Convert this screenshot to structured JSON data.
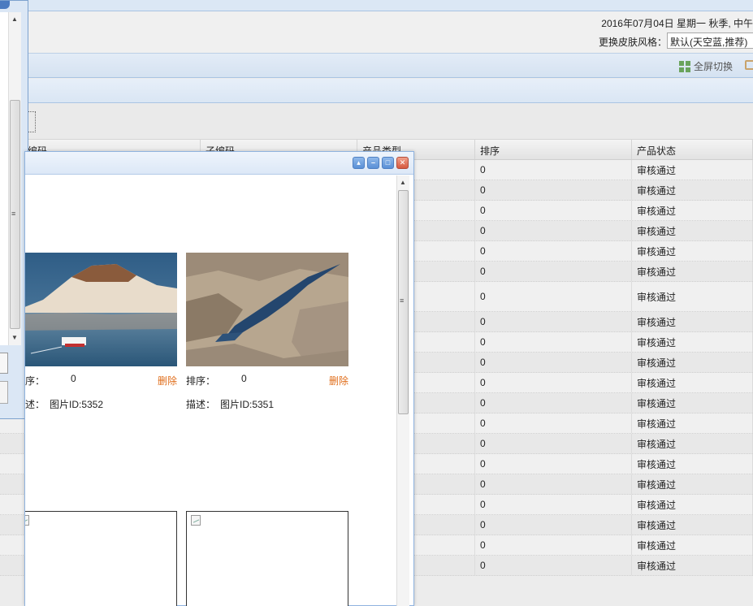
{
  "header": {
    "date_text": "2016年07月04日 星期一 秋季, 中午",
    "skin_label": "更换皮肤风格：",
    "skin_value": "默认(天空蓝,推荐)"
  },
  "toolbar": {
    "fullscreen_label": "全屏切换"
  },
  "grid": {
    "columns": [
      "编码",
      "子编码",
      "产品类型",
      "排序",
      "产品状态"
    ],
    "rows": [
      {
        "sort": "0",
        "status": "审核通过"
      },
      {
        "sort": "0",
        "status": "审核通过"
      },
      {
        "sort": "0",
        "status": "审核通过"
      },
      {
        "sort": "0",
        "status": "审核通过"
      },
      {
        "sort": "0",
        "status": "审核通过"
      },
      {
        "sort": "0",
        "status": "审核通过"
      },
      {
        "sort": "0",
        "status": "审核通过"
      },
      {
        "sort": "0",
        "status": "审核通过"
      },
      {
        "sort": "0",
        "status": "审核通过"
      },
      {
        "sort": "0",
        "status": "审核通过"
      },
      {
        "sort": "0",
        "status": "审核通过"
      },
      {
        "sort": "0",
        "status": "审核通过"
      },
      {
        "sort": "0",
        "status": "审核通过"
      },
      {
        "sort": "0",
        "status": "审核通过"
      },
      {
        "sort": "0",
        "status": "审核通过"
      },
      {
        "sort": "0",
        "status": "审核通过"
      },
      {
        "sort": "0",
        "status": "审核通过"
      },
      {
        "sort": "0",
        "status": "审核通过"
      },
      {
        "sort": "0",
        "status": "审核通过"
      },
      {
        "sort": "0",
        "status": "审核通过"
      }
    ]
  },
  "popup": {
    "cards": [
      {
        "sort_label": "序：",
        "sort_value": "0",
        "delete_label": "删除",
        "desc_label": "述：",
        "desc_value": "图片ID:5352"
      },
      {
        "sort_label": "排序：",
        "sort_value": "0",
        "delete_label": "删除",
        "desc_label": "描述：",
        "desc_value": "图片ID:5351"
      }
    ],
    "window_buttons": [
      "collapse",
      "minimize",
      "maximize",
      "close"
    ]
  }
}
